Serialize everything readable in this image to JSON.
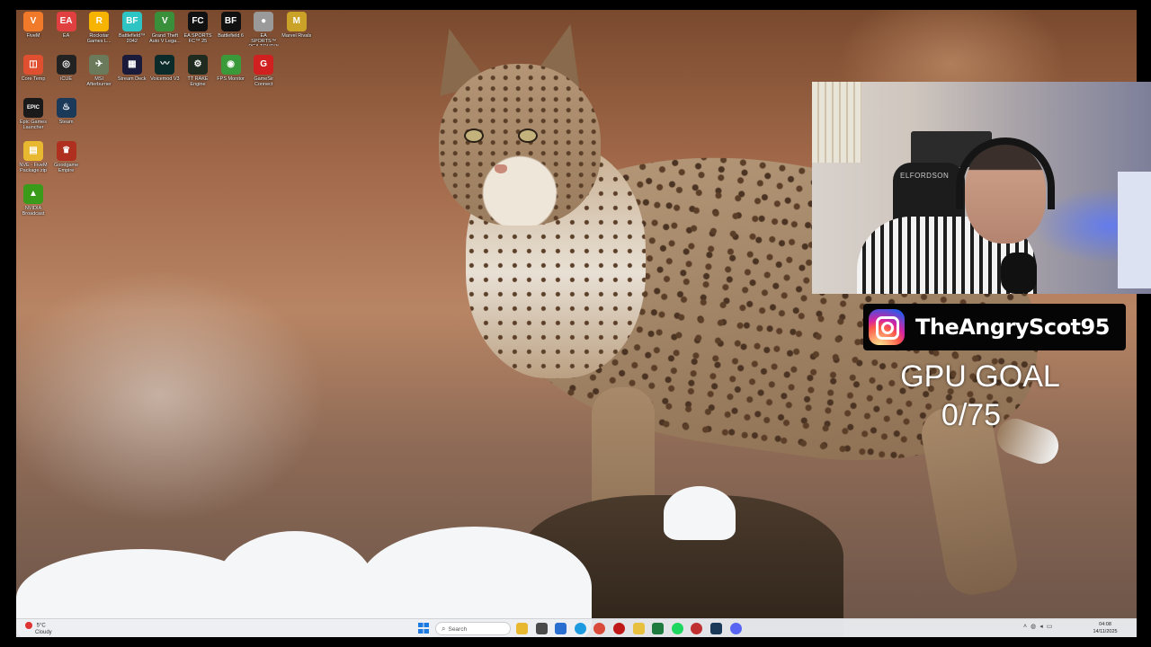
{
  "desktop": {
    "icons": [
      {
        "label": "FiveM",
        "glyph": "V",
        "color": "#f07a2a"
      },
      {
        "label": "EA",
        "glyph": "EA",
        "color": "#e04040"
      },
      {
        "label": "Rockstar Games L...",
        "glyph": "R",
        "color": "#f6b400"
      },
      {
        "label": "Battlefield™ 2042",
        "glyph": "BF",
        "color": "#2ec4c4"
      },
      {
        "label": "Grand Theft Auto V Lega...",
        "glyph": "V",
        "color": "#3a8f3a"
      },
      {
        "label": "EA SPORTS FC™ 25",
        "glyph": "FC",
        "color": "#111111"
      },
      {
        "label": "Battlefield 6",
        "glyph": "BF",
        "color": "#111111"
      },
      {
        "label": "EA SPORTS™ PGA TOUR™",
        "glyph": "●",
        "color": "#9a9a9a"
      },
      {
        "label": "Marvel Rivals",
        "glyph": "M",
        "color": "#c9a227"
      },
      {
        "label": "Core Temp",
        "glyph": "◫",
        "color": "#e05030"
      },
      {
        "label": "iCUE",
        "glyph": "◎",
        "color": "#222222"
      },
      {
        "label": "MSI Afterburner",
        "glyph": "✈",
        "color": "#6a7a5a"
      },
      {
        "label": "Stream Deck",
        "glyph": "▦",
        "color": "#1a1a3a"
      },
      {
        "label": "Voicemod V3",
        "glyph": "〰",
        "color": "#0b2a2a"
      },
      {
        "label": "TT RAKE Engine",
        "glyph": "⚙",
        "color": "#1f2b1f"
      },
      {
        "label": "FPS Monitor",
        "glyph": "◉",
        "color": "#3a9a3a"
      },
      {
        "label": "GameSir Connect",
        "glyph": "G",
        "color": "#d02020"
      },
      {
        "label": "Epic Games Launcher",
        "glyph": "EPIC",
        "color": "#1a1a1a"
      },
      {
        "label": "Steam",
        "glyph": "♨",
        "color": "#1b3a5a"
      },
      {
        "label": "NVE - FiveM Package.zip",
        "glyph": "▤",
        "color": "#e8b830"
      },
      {
        "label": "Goodgame Empire",
        "glyph": "♛",
        "color": "#b03020"
      },
      {
        "label": "NVIDIA Broadcast",
        "glyph": "▲",
        "color": "#3a9a1a"
      }
    ]
  },
  "overlay": {
    "webcam_chair_text": "ELFORDSON",
    "instagram_handle": "TheAngryScot95",
    "goal_title": "GPU GOAL",
    "goal_value": "0/75"
  },
  "taskbar": {
    "weather_temp": "5°C",
    "weather_desc": "Cloudy",
    "search_placeholder": "Search",
    "apps": [
      {
        "name": "file-explorer",
        "color": "#e8b830"
      },
      {
        "name": "task-view",
        "color": "#4a4a4a"
      },
      {
        "name": "store",
        "color": "#2a6fd0"
      },
      {
        "name": "edge",
        "color": "#1e9be0"
      },
      {
        "name": "chrome",
        "color": "#d94a3a"
      },
      {
        "name": "app-red",
        "color": "#c01818"
      },
      {
        "name": "folder",
        "color": "#e8c040"
      },
      {
        "name": "excel",
        "color": "#1e7a3e"
      },
      {
        "name": "spotify",
        "color": "#1ed760"
      },
      {
        "name": "app-circle",
        "color": "#c03030"
      },
      {
        "name": "steam",
        "color": "#1b3a5a"
      },
      {
        "name": "discord",
        "color": "#5865f2"
      }
    ],
    "clock_time": "04:08",
    "clock_date": "14/11/2025"
  }
}
